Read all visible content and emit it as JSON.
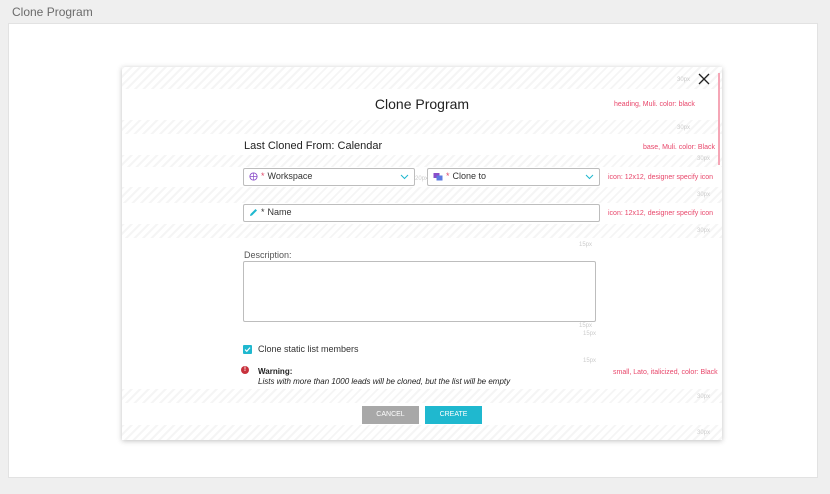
{
  "page_title": "Clone Program",
  "modal": {
    "title": "Clone Program",
    "last_cloned": "Last Cloned From: Calendar",
    "workspace_label": "Workspace",
    "clone_to_label": "Clone to",
    "name_label": "Name",
    "required_mark": "*",
    "description_label": "Description:",
    "description_value": "",
    "checkbox_label": "Clone static list members",
    "checkbox_checked": true,
    "warning_title": "Warning:",
    "warning_text": "Lists with more than 1000 leads will be cloned, but the list will be empty",
    "cancel_label": "CANCEL",
    "create_label": "CREATE"
  },
  "annotations": {
    "heading": "heading, Muli. color: black",
    "base": "base, Muli. color: Black",
    "icon1": "icon: 12x12, designer specify icon",
    "icon2": "icon: 12x12, designer specify icon",
    "small": "small, Lato, italicized, color: Black"
  },
  "spacing": [
    "30px",
    "30px",
    "30px",
    "30px",
    "30px",
    "20px",
    "15px",
    "15px",
    "15px",
    "15px",
    "30px",
    "30px"
  ],
  "colors": {
    "accent": "#1fb8cf",
    "cancel": "#a8a8a8",
    "warning": "#c8323d",
    "annotation": "#e8466a",
    "required": "#e04a6a"
  }
}
